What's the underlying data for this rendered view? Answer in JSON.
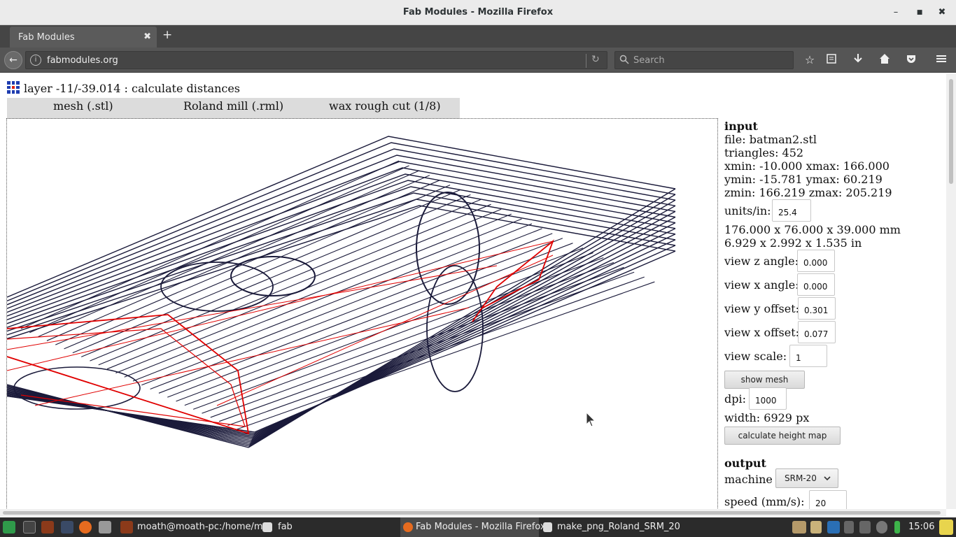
{
  "window": {
    "title": "Fab Modules - Mozilla Firefox",
    "minimize": "–",
    "maximize": "■",
    "close": "✖"
  },
  "tabs": [
    {
      "label": "Fab Modules",
      "close": "✖"
    }
  ],
  "new_tab": "+",
  "nav": {
    "back": "←",
    "url": "fabmodules.org",
    "reload": "↻",
    "search_placeholder": "Search",
    "search_icon": "magnifier-icon",
    "toolbar_icons": [
      "bookmark-star-icon",
      "reading-list-icon",
      "download-icon",
      "home-icon",
      "pocket-icon",
      "hamburger-menu-icon"
    ]
  },
  "page": {
    "status": "layer -11/-39.014 : calculate distances",
    "module_tabs": [
      "mesh (.stl)",
      "Roland mill (.rml)",
      "wax rough cut (1/8)"
    ],
    "panel": {
      "input_heading": "input",
      "file": "file: batman2.stl",
      "triangles": "triangles: 452",
      "x_range": "xmin: -10.000 xmax: 166.000",
      "y_range": "ymin: -15.781 ymax: 60.219",
      "z_range": "zmin: 166.219 zmax: 205.219",
      "units_label": "units/in:",
      "units_value": "25.4",
      "size_mm": "176.000 x 76.000 x 39.000 mm",
      "size_in": "6.929 x 2.992 x 1.535 in",
      "view_z_angle_label": "view z angle:",
      "view_z_angle": "0.000",
      "view_x_angle_label": "view x angle:",
      "view_x_angle": "0.000",
      "view_y_offset_label": "view y offset:",
      "view_y_offset": "0.301",
      "view_x_offset_label": "view x offset:",
      "view_x_offset": "0.077",
      "view_scale_label": "view scale:",
      "view_scale": "1",
      "show_mesh": "show mesh",
      "dpi_label": "dpi:",
      "dpi": "1000",
      "width": "width: 6929 px",
      "calc_button": "calculate height map",
      "output_heading": "output",
      "machine_label": "machine",
      "machine": "SRM-20",
      "speed_label": "speed (mm/s):",
      "speed": "20"
    }
  },
  "taskbar": {
    "items": [
      {
        "label": "moath@moath-pc:/home/m..."
      },
      {
        "label": "fab"
      },
      {
        "label": "Fab Modules - Mozilla Firefox"
      },
      {
        "label": "make_png_Roland_SRM_20"
      }
    ],
    "clock": "15:06"
  },
  "colors": {
    "toolpath": "#1a1a3a",
    "cut_edges": "#e00000",
    "chrome_dark": "#454545"
  }
}
